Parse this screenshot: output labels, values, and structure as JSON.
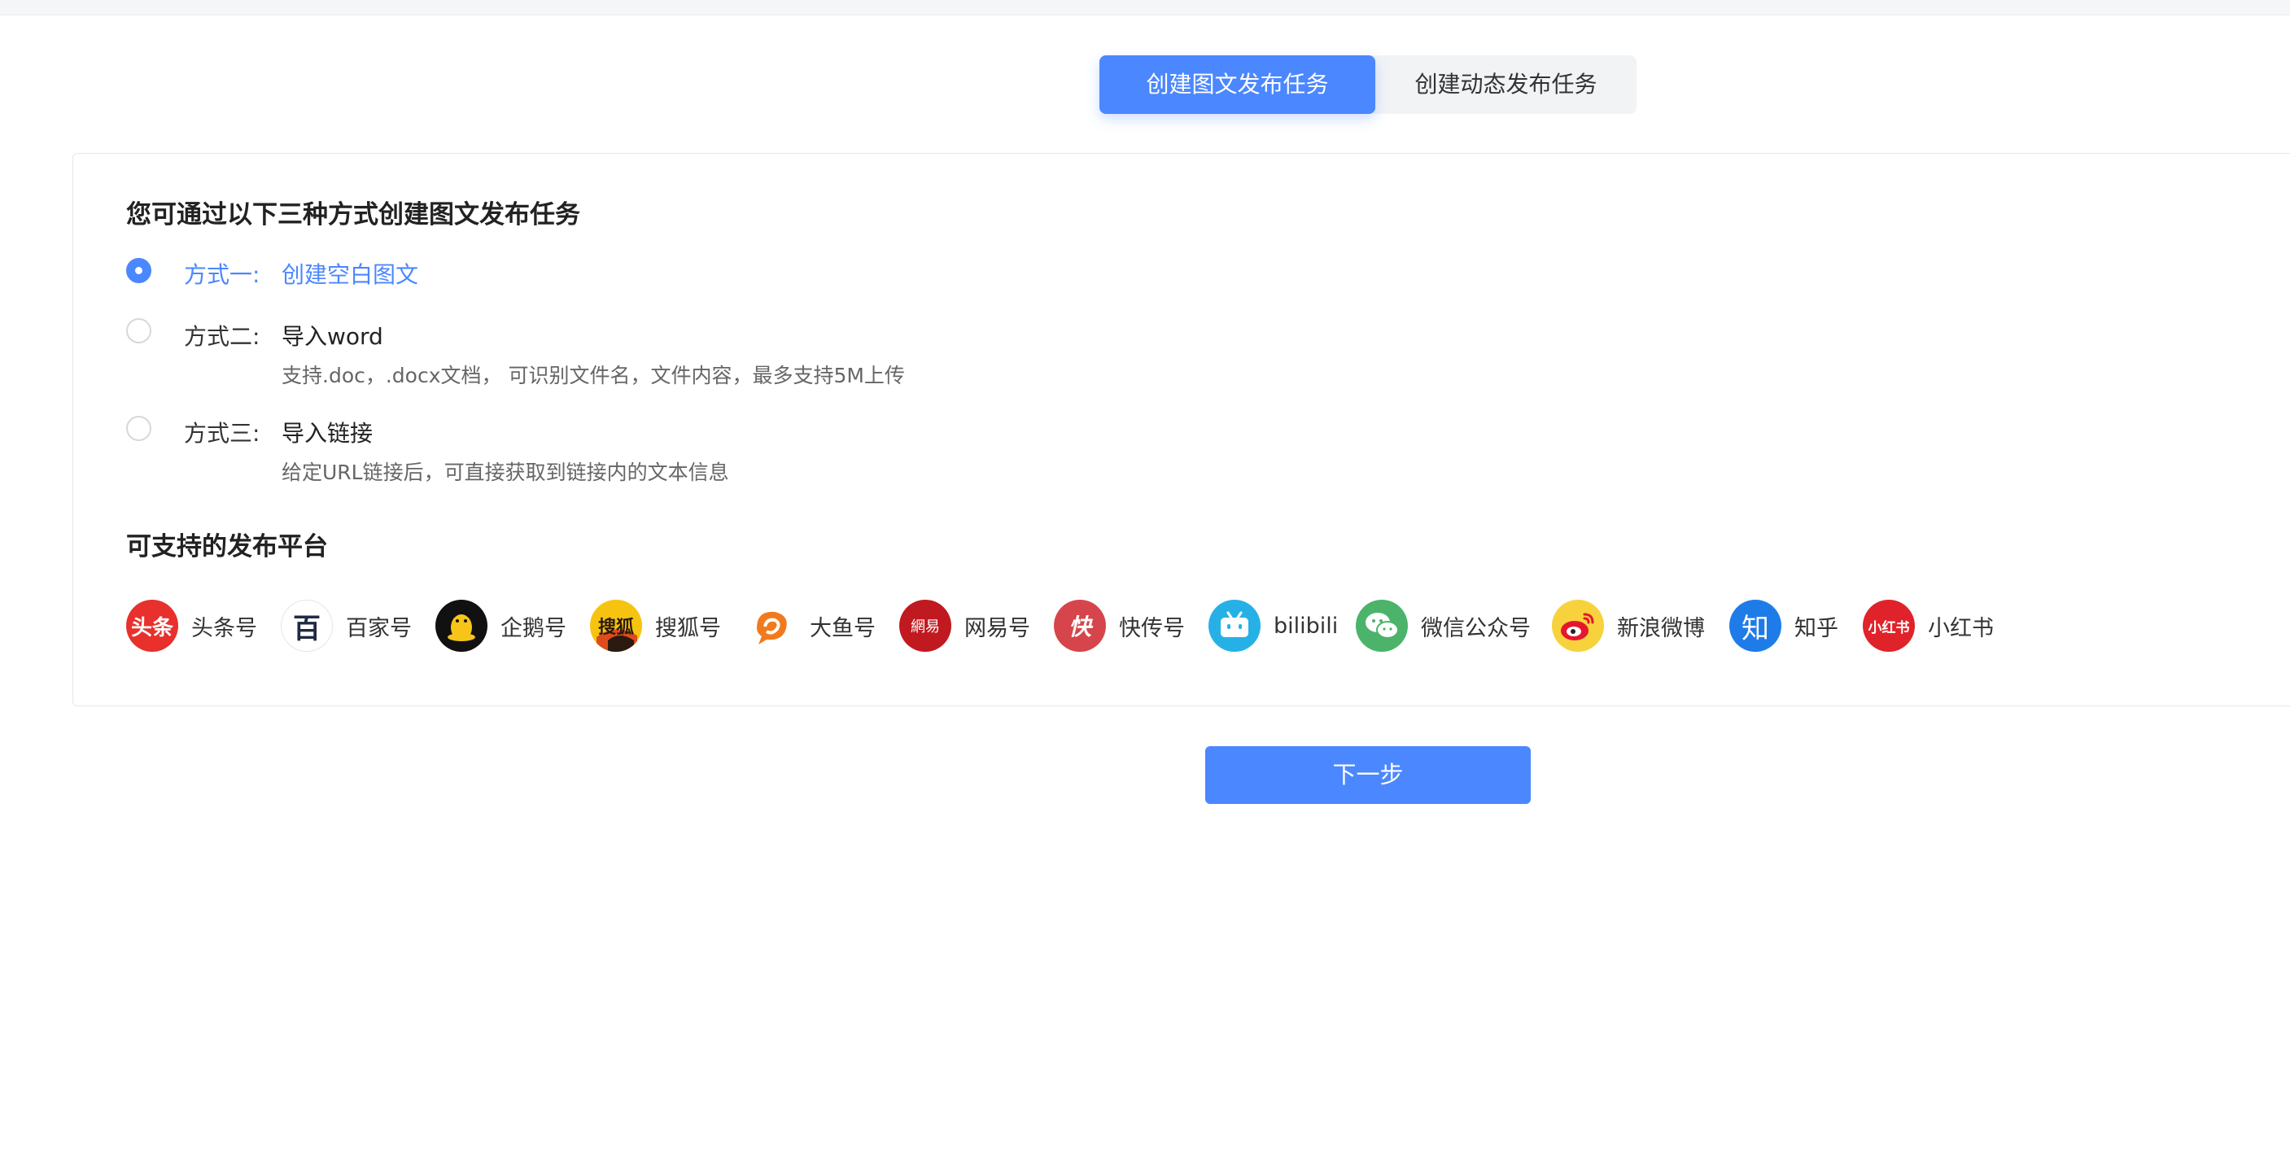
{
  "tabs": {
    "items": [
      {
        "label": "创建图文发布任务",
        "active": true
      },
      {
        "label": "创建动态发布任务",
        "active": false
      }
    ]
  },
  "section_methods": {
    "title": "您可通过以下三种方式创建图文发布任务",
    "options": [
      {
        "prefix": "方式一:",
        "title": "创建空白图文",
        "desc": "",
        "selected": true
      },
      {
        "prefix": "方式二:",
        "title": "导入word",
        "desc": "支持.doc，.docx文档， 可识别文件名，文件内容，最多支持5M上传",
        "selected": false
      },
      {
        "prefix": "方式三:",
        "title": "导入链接",
        "desc": "给定URL链接后，可直接获取到链接内的文本信息",
        "selected": false
      }
    ]
  },
  "section_platforms": {
    "title": "可支持的发布平台",
    "items": [
      {
        "name": "头条号",
        "icon": "toutiao-icon",
        "icon_text": "头条",
        "color": "#e8302c"
      },
      {
        "name": "百家号",
        "icon": "baijiahao-icon",
        "icon_text": "百",
        "color": "#ffffff"
      },
      {
        "name": "企鹅号",
        "icon": "penguin-icon",
        "icon_text": "",
        "color": "#111111"
      },
      {
        "name": "搜狐号",
        "icon": "sohu-icon",
        "icon_text": "搜狐",
        "color": "#f6c410"
      },
      {
        "name": "大鱼号",
        "icon": "dayu-icon",
        "icon_text": "",
        "color": "#ffffff"
      },
      {
        "name": "网易号",
        "icon": "netease-icon",
        "icon_text": "網易",
        "color": "#c11920"
      },
      {
        "name": "快传号",
        "icon": "kuaichuan-icon",
        "icon_text": "快",
        "color": "#d6454b"
      },
      {
        "name": "bilibili",
        "icon": "bilibili-icon",
        "icon_text": "",
        "color": "#26b1e6"
      },
      {
        "name": "微信公众号",
        "icon": "wechat-icon",
        "icon_text": "",
        "color": "#4bb46a"
      },
      {
        "name": "新浪微博",
        "icon": "weibo-icon",
        "icon_text": "",
        "color": "#f7d23d"
      },
      {
        "name": "知乎",
        "icon": "zhihu-icon",
        "icon_text": "知",
        "color": "#1e7ce8"
      },
      {
        "name": "小红书",
        "icon": "xiaohongshu-icon",
        "icon_text": "小红书",
        "color": "#e0232a"
      }
    ]
  },
  "next_button": {
    "label": "下一步"
  },
  "colors": {
    "accent": "#4b87ff",
    "tab_bg": "#f2f3f5",
    "border": "#e4e7ed"
  }
}
